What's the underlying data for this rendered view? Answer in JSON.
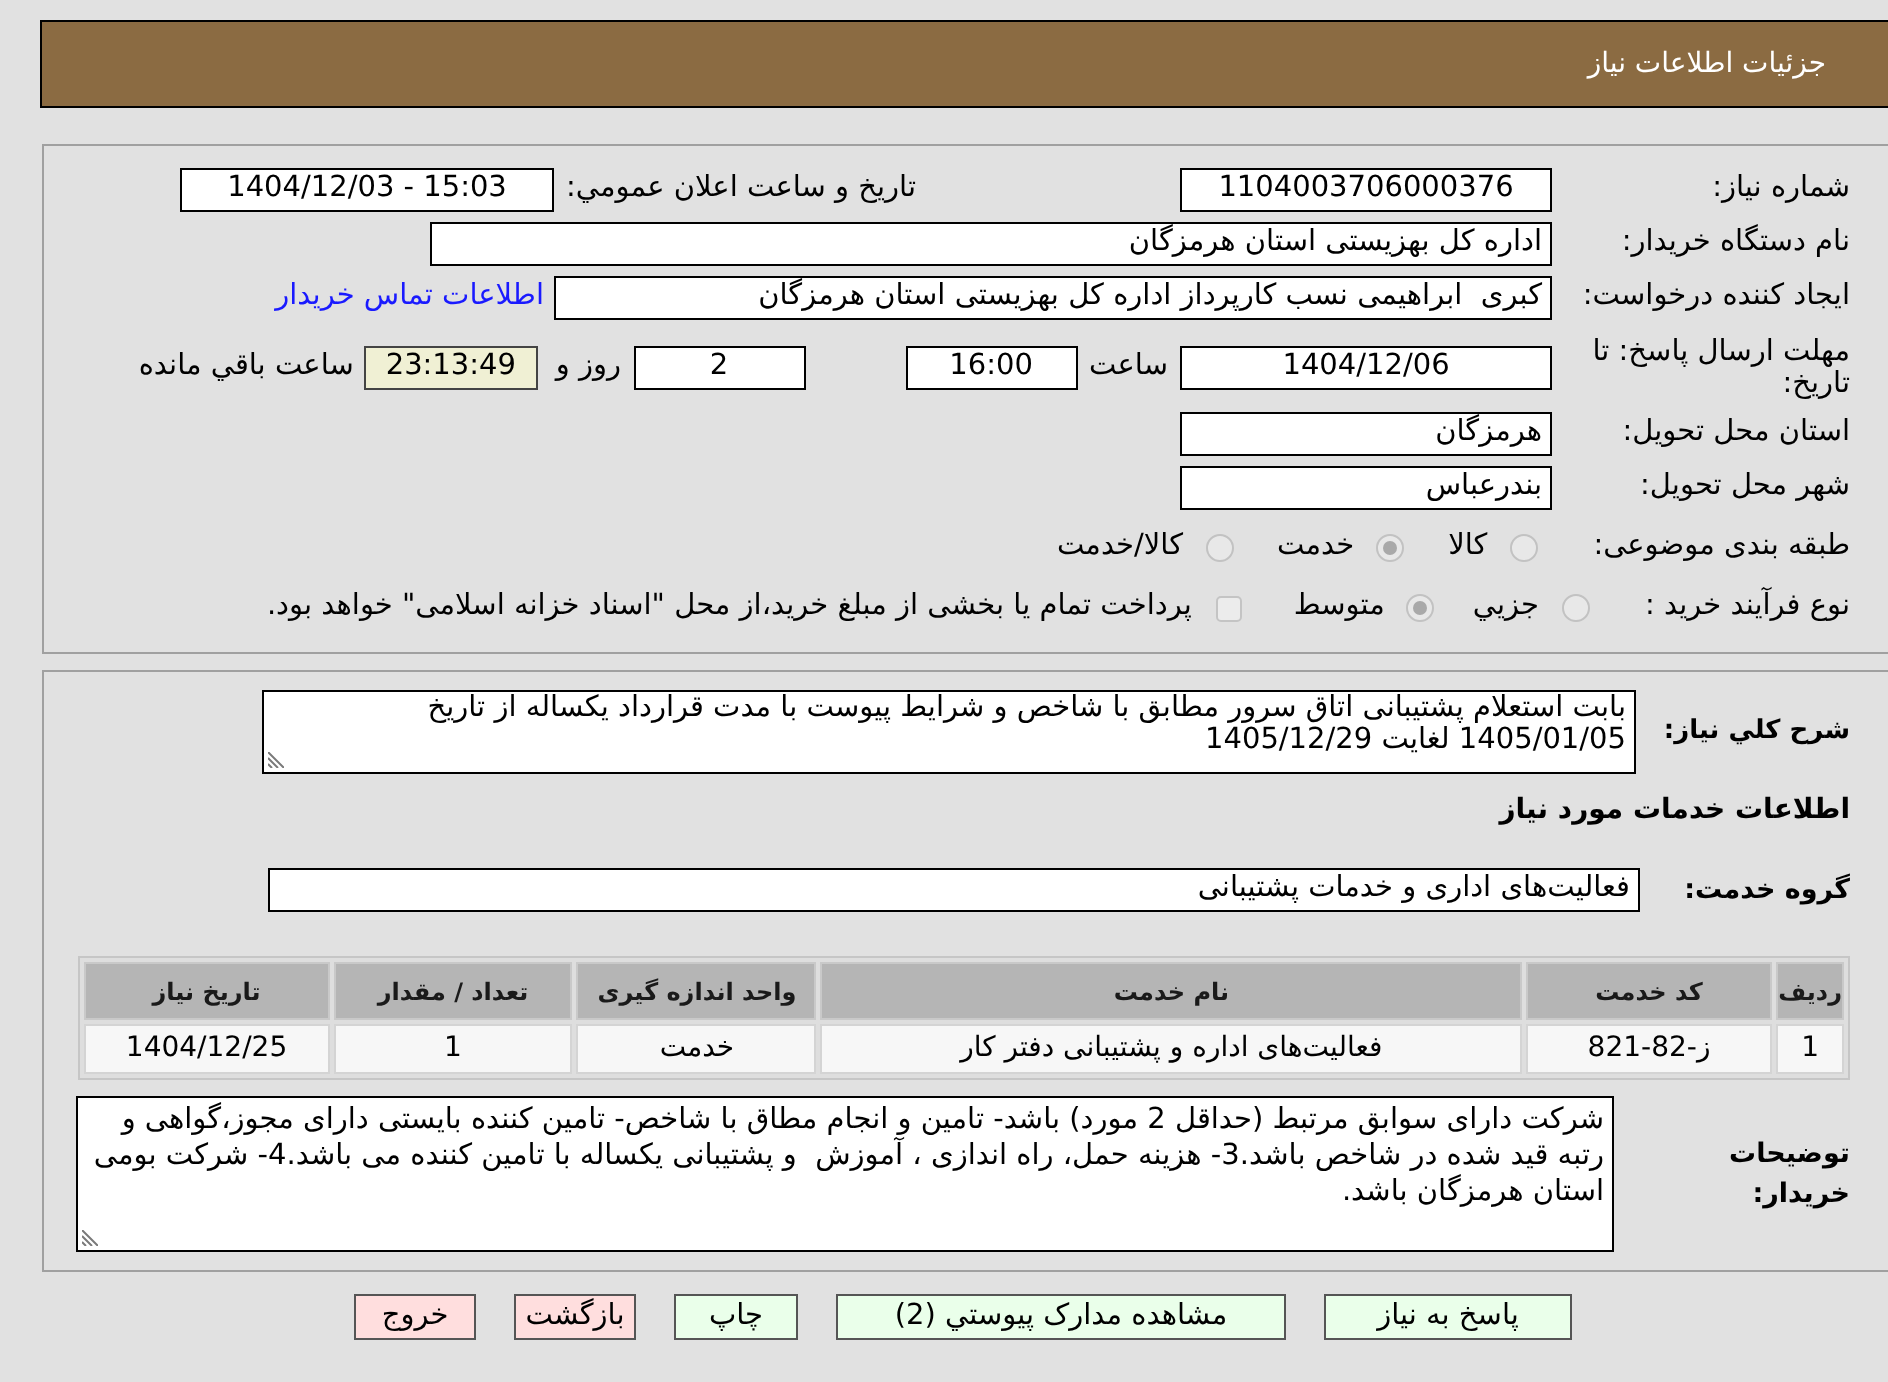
{
  "header": {
    "title": "جزئيات اطلاعات نياز"
  },
  "details": {
    "need_number": {
      "label": "شماره نياز:",
      "value": "1104003706000376"
    },
    "announce": {
      "label": "تاريخ و ساعت اعلان عمومي:",
      "value": "1404/12/03 - 15:03"
    },
    "buyer_org": {
      "label": "نام دستگاه خريدار:",
      "value": "اداره کل بهزیستی استان هرمزگان"
    },
    "requester": {
      "label": "ايجاد کننده درخواست:",
      "value": "کبری  ابراهیمی نسب کارپرداز اداره کل بهزیستی استان هرمزگان",
      "link": "اطلاعات تماس خريدار"
    },
    "deadline": {
      "label": "مهلت ارسال پاسخ: تا تاريخ:",
      "date": "1404/12/06",
      "time_label": "ساعت",
      "time": "16:00",
      "days": "2",
      "days_label": "روز و",
      "remaining": "23:13:49",
      "remaining_label": "ساعت باقي مانده"
    },
    "province": {
      "label": "استان محل تحويل:",
      "value": "هرمزگان"
    },
    "city": {
      "label": "شهر محل تحويل:",
      "value": "بندرعباس"
    },
    "category": {
      "label": "طبقه بندی موضوعی:",
      "options": [
        {
          "label": "کالا",
          "selected": false
        },
        {
          "label": "خدمت",
          "selected": true
        },
        {
          "label": "کالا/خدمت",
          "selected": false
        }
      ]
    },
    "process": {
      "label": "نوع فرآيند خريد :",
      "options": [
        {
          "label": "جزيي",
          "selected": false
        },
        {
          "label": "متوسط",
          "selected": true
        }
      ],
      "treasury": {
        "label": "پرداخت تمام يا بخشی از مبلغ خريد،از محل \"اسناد خزانه اسلامی\" خواهد بود.",
        "checked": false
      }
    }
  },
  "summary": {
    "label": "شرح کلي نياز:",
    "text": "بابت استعلام پشتیبانی اتاق سرور مطابق با شاخص و شرایط پیوست با مدت قرارداد یکساله از تاریخ 1405/01/05 لغایت 1405/12/29"
  },
  "services": {
    "title": "اطلاعات خدمات مورد نياز",
    "group": {
      "label": "گروه خدمت:",
      "value": "فعالیت‌های اداری و خدمات پشتیبانی"
    },
    "table": {
      "columns": [
        "ردیف",
        "کد خدمت",
        "نام خدمت",
        "واحد اندازه گیری",
        "تعداد / مقدار",
        "تاریخ نیاز"
      ],
      "rows": [
        [
          "1",
          "ز-82-821",
          "فعالیت‌های اداره و پشتیبانی دفتر کار",
          "خدمت",
          "1",
          "1404/12/25"
        ]
      ]
    }
  },
  "buyer_notes": {
    "label": "توضيحات خريدار:",
    "text": "شرکت دارای سوابق مرتبط (حداقل 2 مورد) باشد- تامین و انجام مطاق با شاخص- تامین کننده بایستی دارای مجوز،گواهی و رتبه قید شده در شاخص باشد.3- هزینه حمل، راه اندازی ، آموزش  و پشتیبانی یکساله با تامین کننده می باشد.4- شرکت بومی استان هرمزگان باشد."
  },
  "buttons": [
    {
      "label": "پاسخ به نياز",
      "kind": "action"
    },
    {
      "label": "مشاهده مدارک پيوستي (2)",
      "kind": "action"
    },
    {
      "label": "چاپ",
      "kind": "action"
    },
    {
      "label": "بازگشت",
      "kind": "exit"
    },
    {
      "label": "خروج",
      "kind": "exit"
    }
  ]
}
